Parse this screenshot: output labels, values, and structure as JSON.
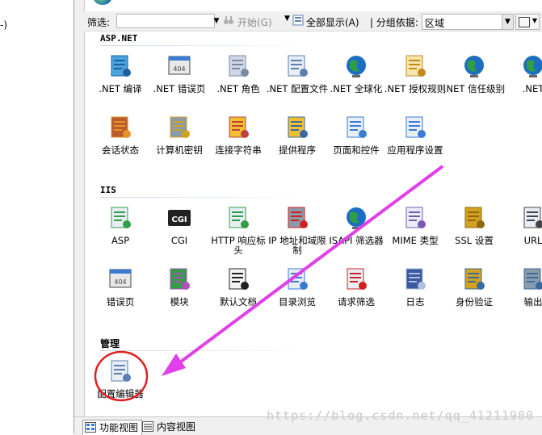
{
  "left_pane": {
    "fragment": "-)"
  },
  "toolbar": {
    "filter_label": "筛选:",
    "filter_value": "",
    "go_label": "开始(G)",
    "show_all_label": "全部显示(A)",
    "group_by_label": "| 分组依据:",
    "group_by_value": "区域"
  },
  "sections": {
    "aspnet": {
      "title": "ASP.NET",
      "items": [
        {
          "label": ".NET 编译",
          "icon": "dotnet-compile-icon"
        },
        {
          "label": ".NET 错误页",
          "icon": "dotnet-error-page-icon"
        },
        {
          "label": ".NET 角色",
          "icon": "dotnet-roles-icon"
        },
        {
          "label": ".NET 配置文件",
          "icon": "dotnet-profile-icon"
        },
        {
          "label": ".NET 全球化",
          "icon": "dotnet-globalization-icon"
        },
        {
          "label": ".NET 授权规则",
          "icon": "dotnet-authorization-icon"
        },
        {
          "label": ".NET 信任级别",
          "icon": "dotnet-trust-level-icon"
        },
        {
          "label": ".NET",
          "icon": "dotnet-more-icon"
        },
        {
          "label": "会话状态",
          "icon": "session-state-icon"
        },
        {
          "label": "计算机密钥",
          "icon": "machine-key-icon"
        },
        {
          "label": "连接字符串",
          "icon": "connection-strings-icon"
        },
        {
          "label": "提供程序",
          "icon": "providers-icon"
        },
        {
          "label": "页面和控件",
          "icon": "pages-controls-icon"
        },
        {
          "label": "应用程序设置",
          "icon": "app-settings-icon"
        }
      ]
    },
    "iis": {
      "title": "IIS",
      "items": [
        {
          "label": "ASP",
          "icon": "asp-icon"
        },
        {
          "label": "CGI",
          "icon": "cgi-icon"
        },
        {
          "label": "HTTP 响应标头",
          "icon": "http-headers-icon"
        },
        {
          "label": "IP 地址和域限制",
          "icon": "ip-restrictions-icon"
        },
        {
          "label": "ISAPI 筛选器",
          "icon": "isapi-filters-icon"
        },
        {
          "label": "MIME 类型",
          "icon": "mime-types-icon"
        },
        {
          "label": "SSL 设置",
          "icon": "ssl-settings-icon"
        },
        {
          "label": "URL",
          "icon": "url-rewrite-icon"
        },
        {
          "label": "错误页",
          "icon": "error-pages-icon"
        },
        {
          "label": "模块",
          "icon": "modules-icon"
        },
        {
          "label": "默认文档",
          "icon": "default-document-icon"
        },
        {
          "label": "目录浏览",
          "icon": "directory-browsing-icon"
        },
        {
          "label": "请求筛选",
          "icon": "request-filtering-icon"
        },
        {
          "label": "日志",
          "icon": "logging-icon"
        },
        {
          "label": "身份验证",
          "icon": "authentication-icon"
        },
        {
          "label": "输出",
          "icon": "output-caching-icon"
        }
      ]
    },
    "management": {
      "title": "管理",
      "items": [
        {
          "label": "配置编辑器",
          "icon": "configuration-editor-icon"
        }
      ]
    }
  },
  "bottom_tabs": [
    {
      "label": "功能视图",
      "active": true
    },
    {
      "label": "内容视图",
      "active": false
    }
  ],
  "watermark": "https://blog.csdn.net/qq_41211900",
  "annotation_colors": {
    "arrow": "#e040e8",
    "circle": "#e02020"
  }
}
